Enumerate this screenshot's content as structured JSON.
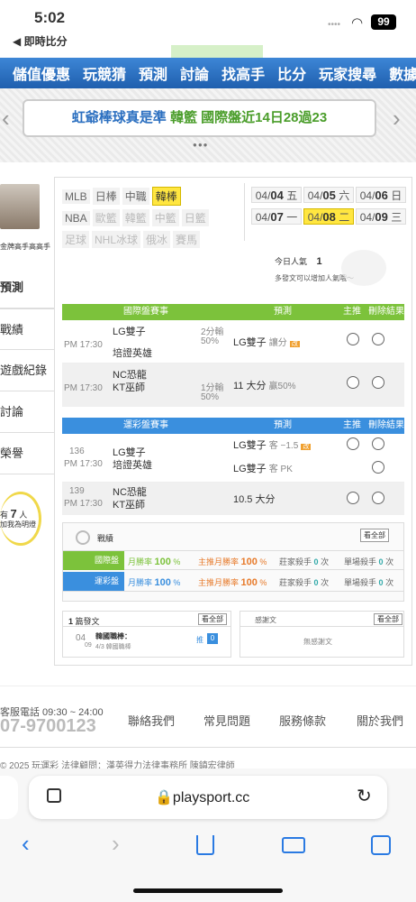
{
  "status_bar": {
    "time": "5:02",
    "back_label": "◀ 即時比分",
    "battery": "99"
  },
  "nav": {
    "items": [
      "儲值優惠",
      "玩競猜",
      "預測",
      "討論",
      "找高手",
      "比分",
      "玩家搜尋",
      "數據"
    ]
  },
  "banner": {
    "text_a": "虹爺棒球真是準",
    "text_b": "韓籃",
    "text_c": "國際盤近14日28過23"
  },
  "sidebar": {
    "user_label": "金牌高手高高手",
    "items": [
      "預測",
      "戰績",
      "遊戲紀錄",
      "討論",
      "榮譽"
    ],
    "popularity_a": "有",
    "popularity_num": "7",
    "popularity_b": "人",
    "popularity_c": "加我為明燈"
  },
  "leagues": {
    "row1": [
      "MLB",
      "日棒",
      "中職",
      "韓棒"
    ],
    "row2": [
      "NBA",
      "歐籃",
      "韓籃",
      "中籃",
      "日籃"
    ],
    "row3": [
      "足球",
      "NHL冰球",
      "俄冰",
      "賽馬"
    ]
  },
  "dates": [
    {
      "d": "04/",
      "b": "04",
      "w": "五"
    },
    {
      "d": "04/",
      "b": "05",
      "w": "六"
    },
    {
      "d": "04/",
      "b": "06",
      "w": "日"
    },
    {
      "d": "04/",
      "b": "07",
      "w": "一"
    },
    {
      "d": "04/",
      "b": "08",
      "w": "二"
    },
    {
      "d": "04/",
      "b": "09",
      "w": "三"
    }
  ],
  "popularity": {
    "label": "今日人氣",
    "value": "1",
    "hint": "多發文可以增加人氣哦～"
  },
  "intl": {
    "header": "國際盤賽事",
    "col_pred": "預測",
    "col_main": "主推",
    "col_del": "刪除",
    "col_res": "結果",
    "games": [
      {
        "time": "PM 17:30",
        "team1": "LG雙子",
        "team2": "培證英雄",
        "line": "2分輸",
        "pct": "50%",
        "pick": "LG雙子",
        "pick_note": "讓分"
      },
      {
        "time": "PM 17:30",
        "team1": "NC恐龍",
        "team2": "KT巫師",
        "line": "1分輸",
        "pct": "50%",
        "pick": "11 大分",
        "pick_note": "贏50%"
      }
    ]
  },
  "lottery": {
    "header": "運彩盤賽事",
    "col_pred": "預測",
    "col_main": "主推",
    "col_del": "刪除",
    "col_res": "結果",
    "games": [
      {
        "no": "136",
        "time": "PM 17:30",
        "team1": "LG雙子",
        "team2": "培證英雄",
        "pick1": "LG雙子",
        "note1": "客 −1.5",
        "pick2": "LG雙子",
        "note2": "客 PK"
      },
      {
        "no": "139",
        "time": "PM 17:30",
        "team1": "NC恐龍",
        "team2": "KT巫師",
        "pick": "10.5 大分"
      }
    ]
  },
  "record": {
    "title": "戰績",
    "all": "看全部",
    "rows": [
      {
        "name": "國際盤",
        "a_label": "月勝率",
        "a_val": "100",
        "b_label": "主推月勝率",
        "b_val": "100",
        "c_label": "莊家殺手",
        "c_val": "0",
        "c_unit": "次",
        "d_label": "單場殺手",
        "d_val": "0",
        "d_unit": "次"
      },
      {
        "name": "運彩盤",
        "a_label": "月勝率",
        "a_val": "100",
        "b_label": "主推月勝率",
        "b_val": "100",
        "c_label": "莊家殺手",
        "c_val": "0",
        "c_unit": "次",
        "d_label": "單場殺手",
        "d_val": "0",
        "d_unit": "次"
      }
    ]
  },
  "posts": {
    "count": "1",
    "label": "篇發文",
    "all": "看全部",
    "item_date_m": "04",
    "item_date_d": "09",
    "item_title": "韓國職棒：",
    "item_sub": "4/3 韓國職棒",
    "push_label": "推",
    "push_val": "0"
  },
  "thanks": {
    "label": "感謝文",
    "all": "看全部",
    "empty": "無感謝文"
  },
  "footer": {
    "phone_label": "客服電話 09:30 ~ 24:00",
    "phone": "07-9700123",
    "links": [
      "聯絡我們",
      "常見問題",
      "服務條款",
      "關於我們"
    ],
    "copyright": "© 2025 玩運彩 法律顧問：漢英得力法律事務所 陳鎮宏律師"
  },
  "browser": {
    "url": "playsport.cc"
  },
  "colors": {
    "nav": "#2a6fc4",
    "intl": "#7cc23b",
    "lottery": "#3a8fde",
    "highlight": "#ffe640"
  }
}
